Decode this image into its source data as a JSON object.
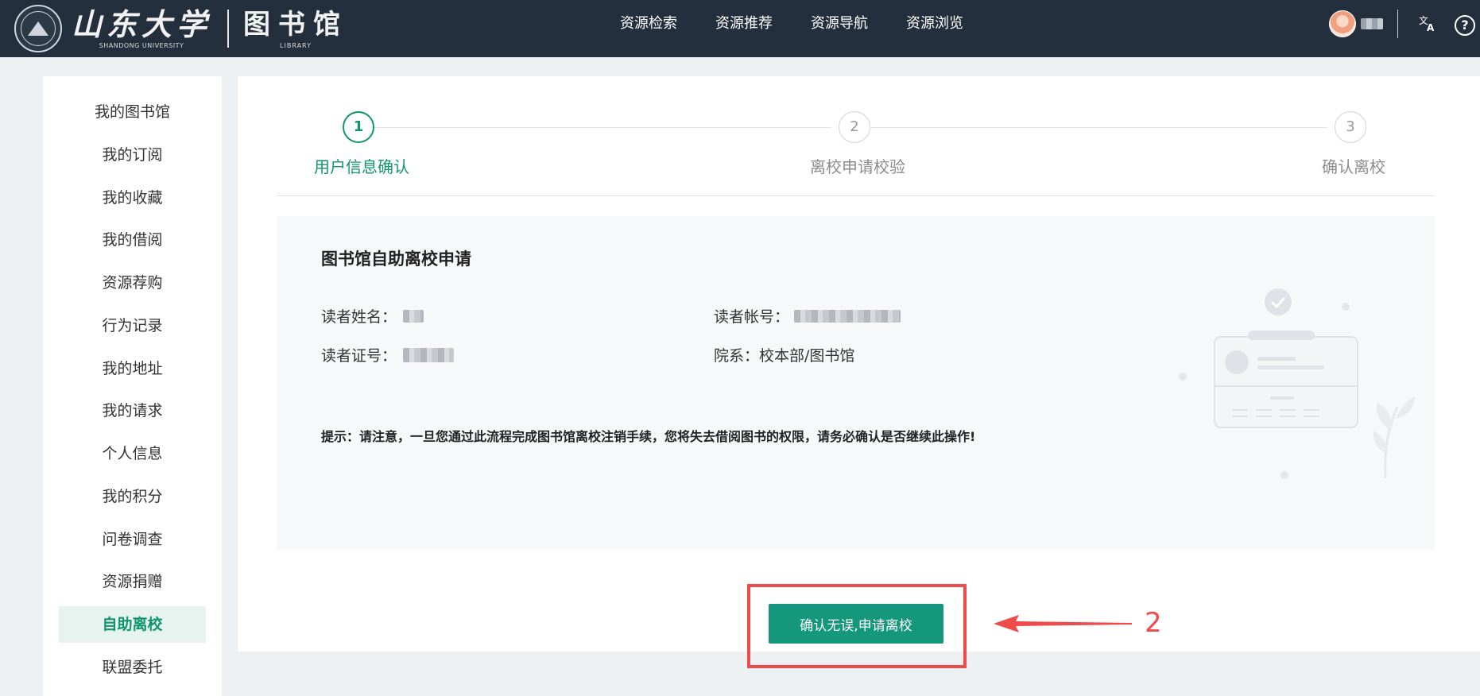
{
  "header": {
    "brand_cn": "山东大学",
    "brand_en": "SHANDONG UNIVERSITY",
    "library_cn": "图书馆",
    "library_en": "LIBRARY",
    "nav": [
      "资源检索",
      "资源推荐",
      "资源导航",
      "资源浏览"
    ],
    "icons": [
      "university-seal-icon",
      "avatar",
      "translate-icon",
      "help-icon"
    ]
  },
  "sidebar": {
    "items": [
      "我的图书馆",
      "我的订阅",
      "我的收藏",
      "我的借阅",
      "资源荐购",
      "行为记录",
      "我的地址",
      "我的请求",
      "个人信息",
      "我的积分",
      "问卷调查",
      "资源捐赠",
      "自助离校",
      "联盟委托"
    ],
    "active_index": 12
  },
  "steps": [
    {
      "num": "1",
      "label": "用户信息确认",
      "active": true
    },
    {
      "num": "2",
      "label": "离校申请校验",
      "active": false
    },
    {
      "num": "3",
      "label": "确认离校",
      "active": false
    }
  ],
  "info": {
    "title": "图书馆自助离校申请",
    "reader_name_label": "读者姓名：",
    "reader_account_label": "读者帐号：",
    "reader_card_label": "读者证号：",
    "department_label": "院系：",
    "department_value": "校本部/图书馆",
    "notice": "提示：请注意，一旦您通过此流程完成图书馆离校注销手续，您将失去借阅图书的权限，请务必确认是否继续此操作!"
  },
  "actions": {
    "confirm_label": "确认无误,申请离校"
  },
  "annotation": {
    "number": "2",
    "color": "#ef4b4b"
  },
  "colors": {
    "header_bg": "#232f3c",
    "accent": "#11956f",
    "button": "#14977a",
    "page_bg": "#eef1f4"
  }
}
